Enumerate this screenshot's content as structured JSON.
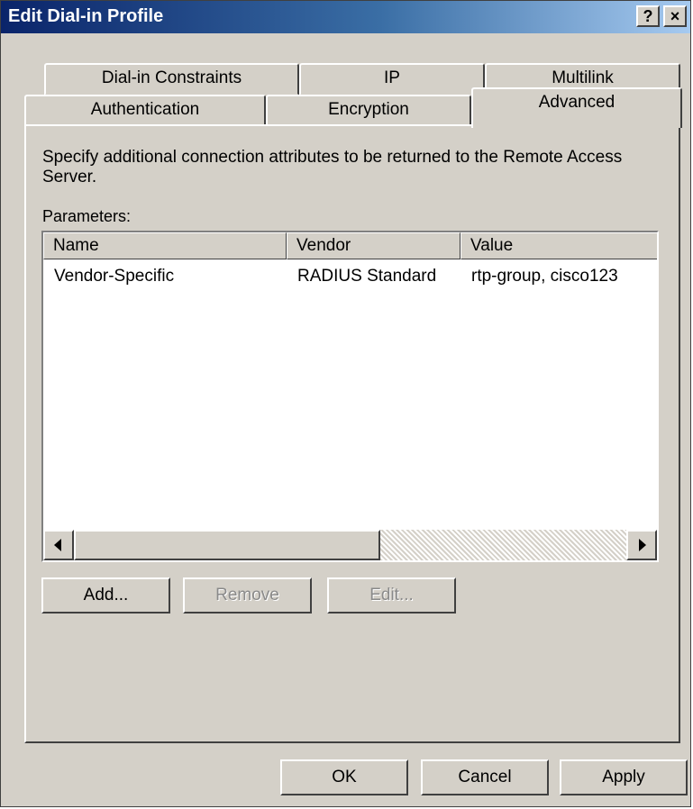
{
  "window": {
    "title": "Edit Dial-in Profile"
  },
  "title_buttons": {
    "help": "?",
    "close": "×"
  },
  "tabs": {
    "row1": [
      "Dial-in Constraints",
      "IP",
      "Multilink"
    ],
    "row2": [
      "Authentication",
      "Encryption",
      "Advanced"
    ],
    "selected": "Advanced"
  },
  "advanced": {
    "description": "Specify additional connection attributes to be returned to the Remote Access Server.",
    "parameters_label": "Parameters:",
    "columns": [
      "Name",
      "Vendor",
      "Value"
    ],
    "rows": [
      [
        "Vendor-Specific",
        "RADIUS Standard",
        "rtp-group, cisco123"
      ]
    ],
    "buttons": {
      "add": "Add...",
      "remove": "Remove",
      "edit": "Edit..."
    }
  },
  "footer": {
    "ok": "OK",
    "cancel": "Cancel",
    "apply": "Apply"
  },
  "colors": {
    "face": "#d4d0c8",
    "title_start": "#0a246a",
    "title_end": "#a6caf0"
  },
  "icons": [
    "help-icon",
    "close-icon",
    "scroll-left-icon",
    "scroll-right-icon"
  ]
}
